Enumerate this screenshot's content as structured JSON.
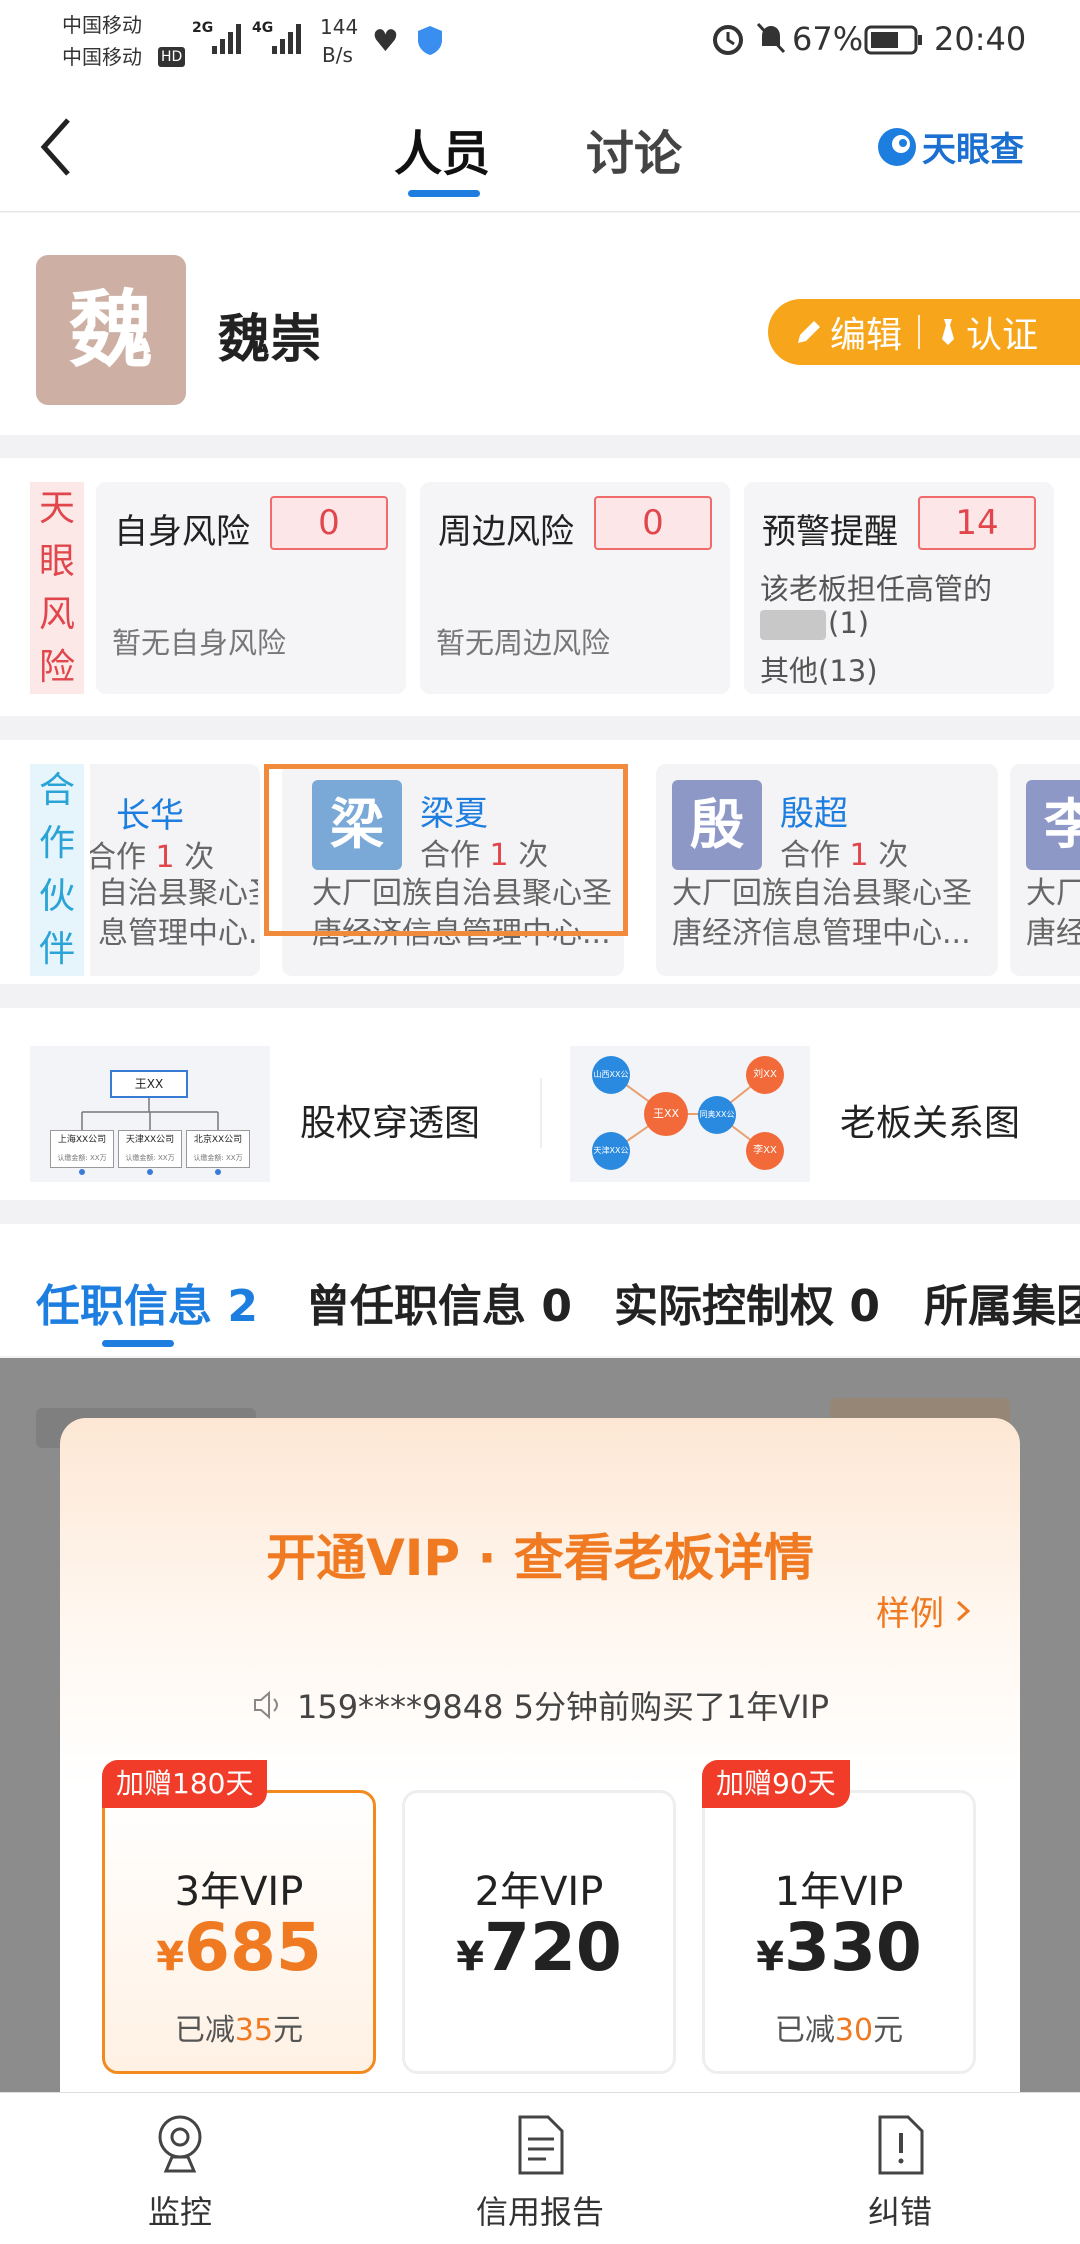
{
  "status": {
    "carrier1": "中国移动",
    "carrier2": "中国移动",
    "hd": "HD",
    "net1": "2G",
    "net2": "4G",
    "speed_val": "144",
    "speed_unit": "B/s",
    "battery": "67%",
    "time": "20:40"
  },
  "header": {
    "tab_people": "人员",
    "tab_discuss": "讨论",
    "brand": "天眼查"
  },
  "profile": {
    "avatar_char": "魏",
    "name": "魏崇",
    "edit": "编辑",
    "certify": "认证"
  },
  "risk": {
    "label": [
      "天",
      "眼",
      "风",
      "险"
    ],
    "self": {
      "title": "自身风险",
      "count": "0",
      "desc": "暂无自身风险"
    },
    "around": {
      "title": "周边风险",
      "count": "0",
      "desc": "暂无周边风险"
    },
    "alert": {
      "title": "预警提醒",
      "count": "14",
      "line1": "该老板担任高管的",
      "line2": "(1)",
      "line3": "其他(13)"
    }
  },
  "partners": {
    "label": [
      "合",
      "作",
      "伙",
      "伴"
    ],
    "items": [
      {
        "char": "",
        "name": "长华",
        "coop_prefix": "合作",
        "times": "1",
        "coop_suffix": "次",
        "desc1": "自治县聚心圣",
        "desc2": "息管理中心..."
      },
      {
        "char": "梁",
        "name": "梁夏",
        "coop_prefix": "合作",
        "times": "1",
        "coop_suffix": "次",
        "desc1": "大厂回族自治县聚心圣",
        "desc2": "唐经济信息管理中心..."
      },
      {
        "char": "殷",
        "name": "殷超",
        "coop_prefix": "合作",
        "times": "1",
        "coop_suffix": "次",
        "desc1": "大厂回族自治县聚心圣",
        "desc2": "唐经济信息管理中心..."
      },
      {
        "char": "李",
        "name": "",
        "coop_prefix": "",
        "times": "",
        "coop_suffix": "",
        "desc1": "大厂",
        "desc2": "唐经"
      }
    ]
  },
  "graphs": {
    "equity": "股权穿透图",
    "relation": "老板关系图",
    "equity_thumb": {
      "top": "王XX",
      "b1": "上海XX公司",
      "b2": "天津XX公司",
      "b3": "北京XX公司",
      "sub": "认缴金额: XX万"
    },
    "relation_thumb": {
      "center": "王XX",
      "n1": "山西XX公司",
      "n2": "天津XX公司",
      "n3": "刘XX",
      "n4": "同奥XX公司",
      "n5": "李XX"
    }
  },
  "tabs": {
    "t1": "任职信息 2",
    "t2": "曾任职信息 0",
    "t3": "实际控制权 0",
    "t4": "所属集团"
  },
  "vip": {
    "title": "开通VIP · 查看老板详情",
    "sample": "样例",
    "notice": "159****9848 5分钟前购买了1年VIP",
    "plans": [
      {
        "gift": "加赠180天",
        "name": "3年VIP",
        "yen": "¥",
        "price": "685",
        "cut_pre": "已减",
        "cut": "35",
        "cut_post": "元"
      },
      {
        "gift": "",
        "name": "2年VIP",
        "yen": "¥",
        "price": "720",
        "cut_pre": "",
        "cut": "",
        "cut_post": ""
      },
      {
        "gift": "加赠90天",
        "name": "1年VIP",
        "yen": "¥",
        "price": "330",
        "cut_pre": "已减",
        "cut": "30",
        "cut_post": "元"
      }
    ]
  },
  "nav": {
    "monitor": "监控",
    "report": "信用报告",
    "correct": "纠错"
  },
  "colors": {
    "accent": "#1e7ee0",
    "orange": "#f28a1e",
    "red": "#e0464c"
  }
}
